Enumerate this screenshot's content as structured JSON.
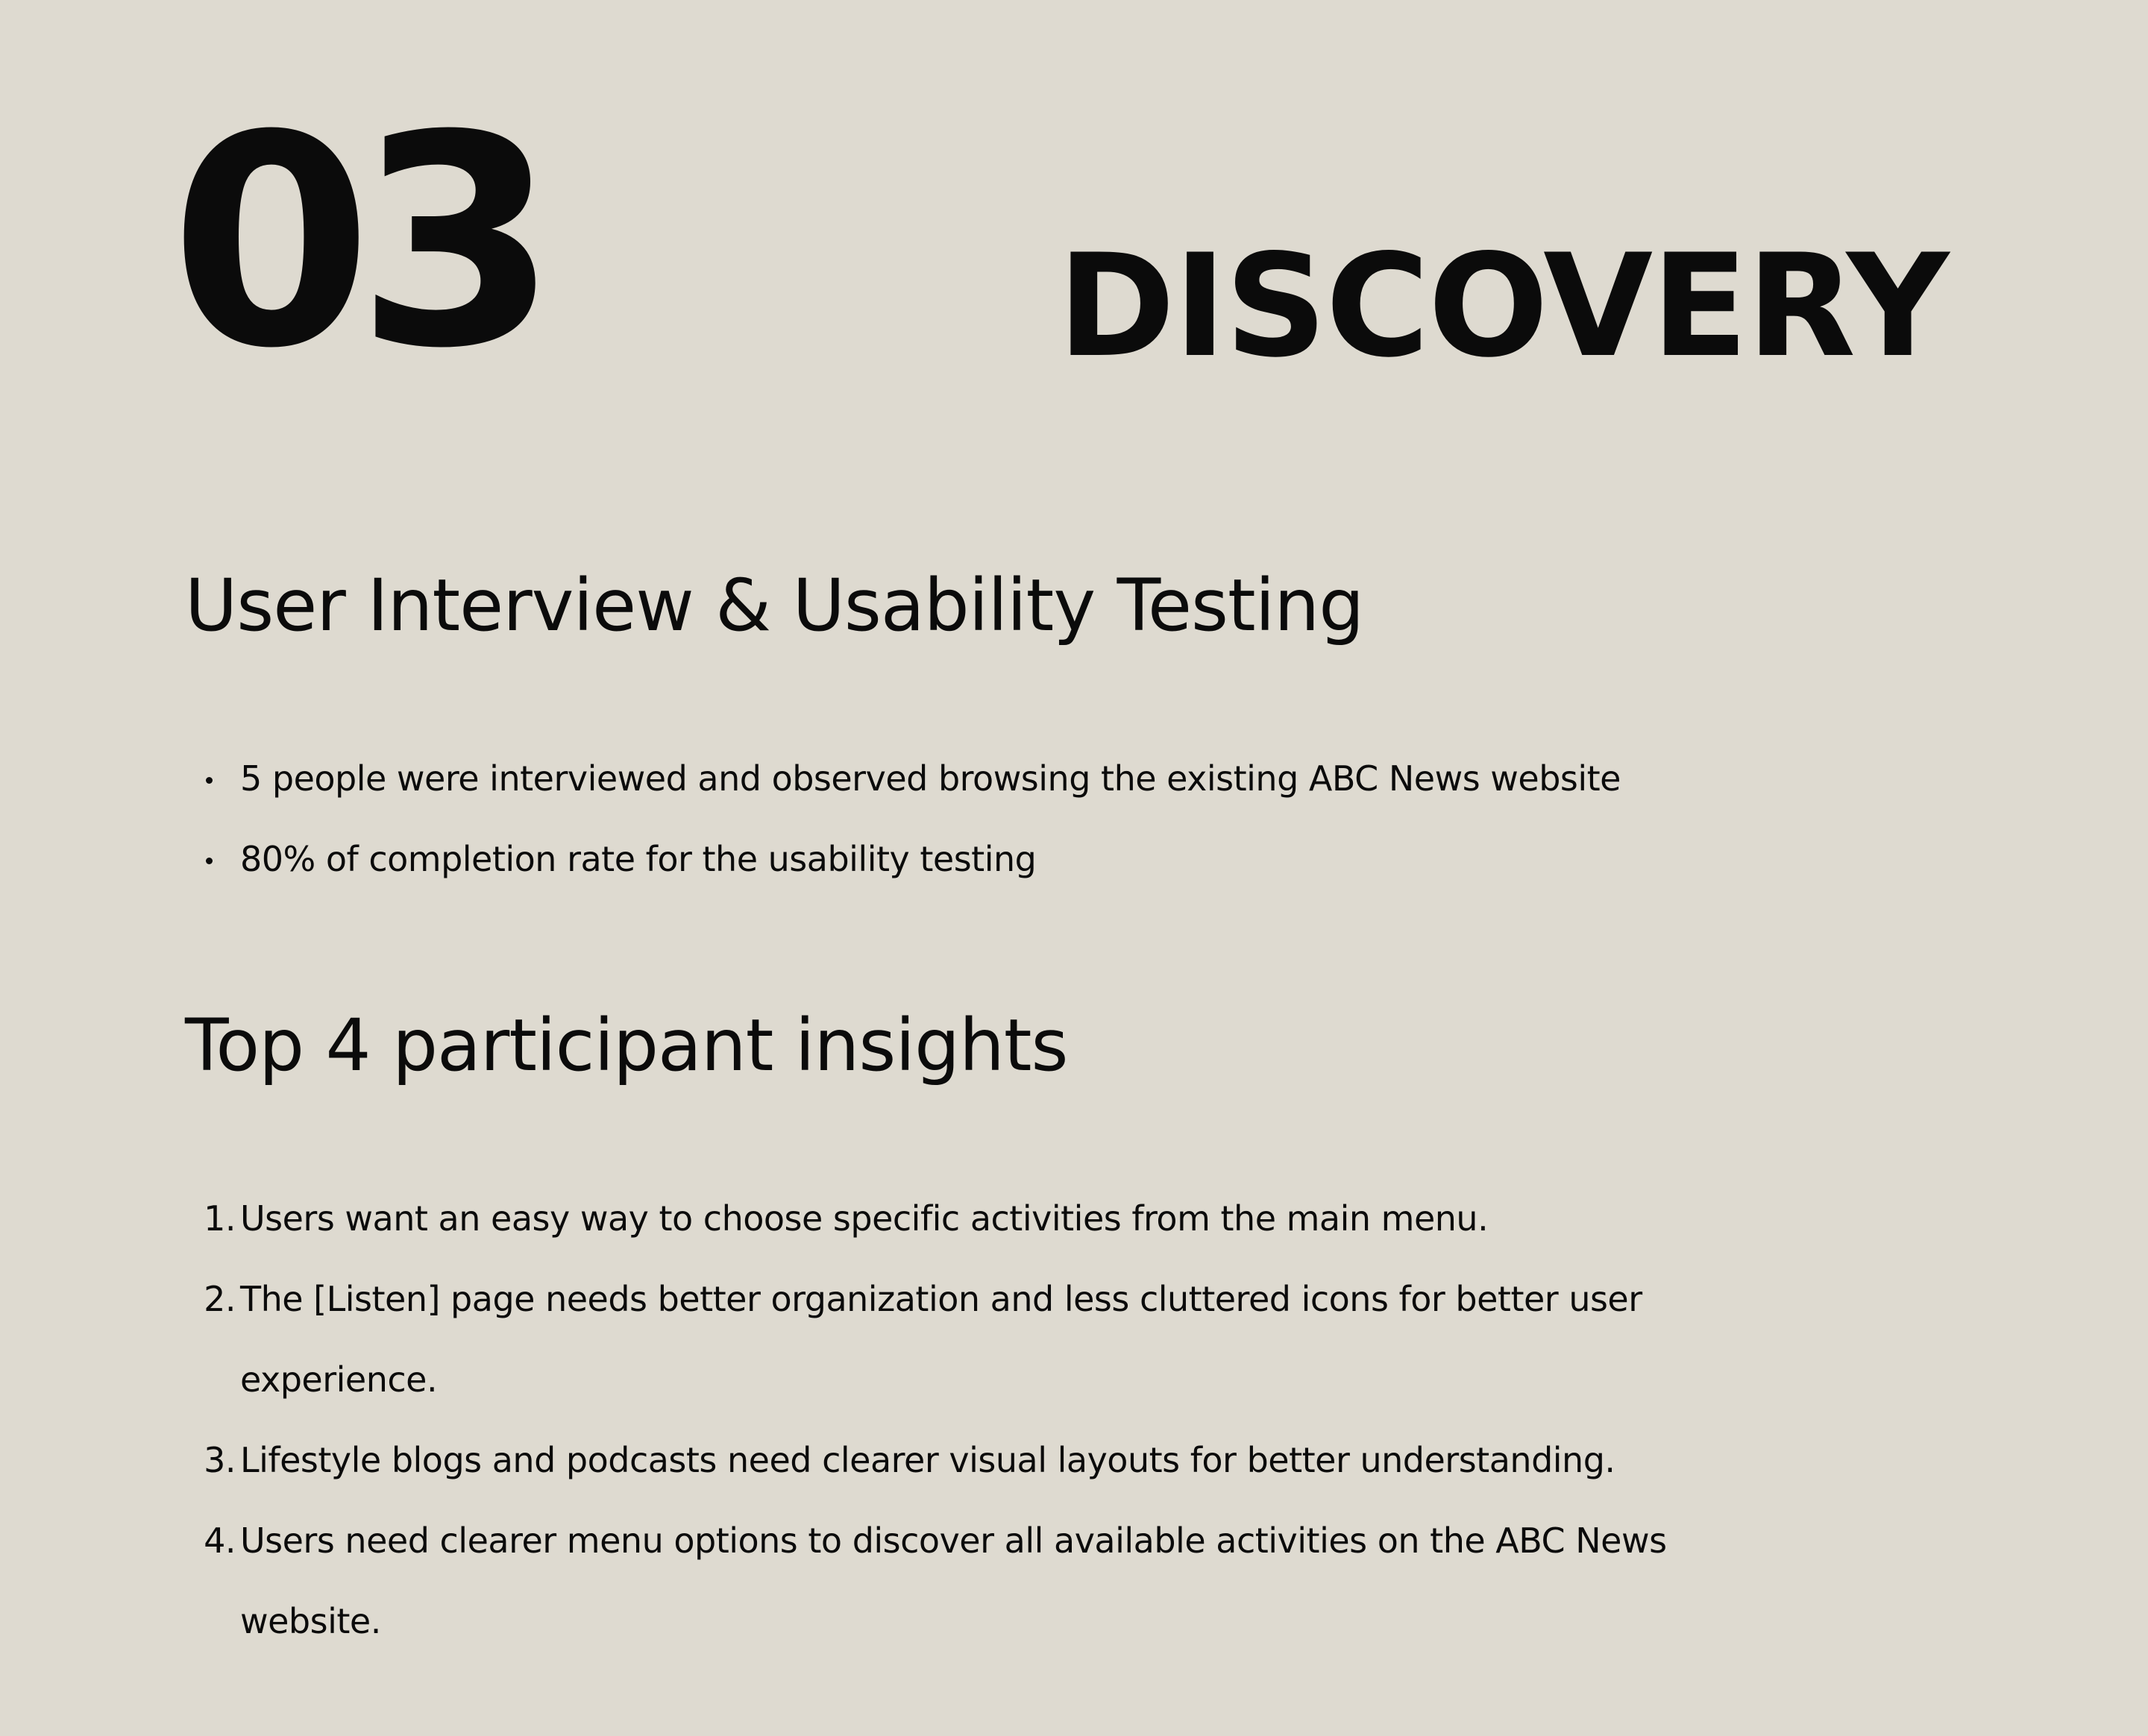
{
  "section_number": "03",
  "section_title": "DISCOVERY",
  "interview": {
    "heading": "User Interview & Usability Testing",
    "bullets": [
      "5 people were interviewed and observed browsing the existing ABC News website",
      "80% of completion rate for the usability testing"
    ]
  },
  "insights": {
    "heading": "Top 4 participant insights",
    "items": [
      {
        "marker": "1.",
        "text": "Users want an easy way to choose specific activities from the main menu."
      },
      {
        "marker": "2.",
        "text": "The [Listen] page needs better organization and less cluttered icons for better user experience."
      },
      {
        "marker": "3.",
        "text": "Lifestyle blogs and podcasts need clearer visual layouts for better understanding."
      },
      {
        "marker": "4.",
        "text": "Users need clearer menu options to discover all available activities on the ABC News website."
      }
    ]
  }
}
